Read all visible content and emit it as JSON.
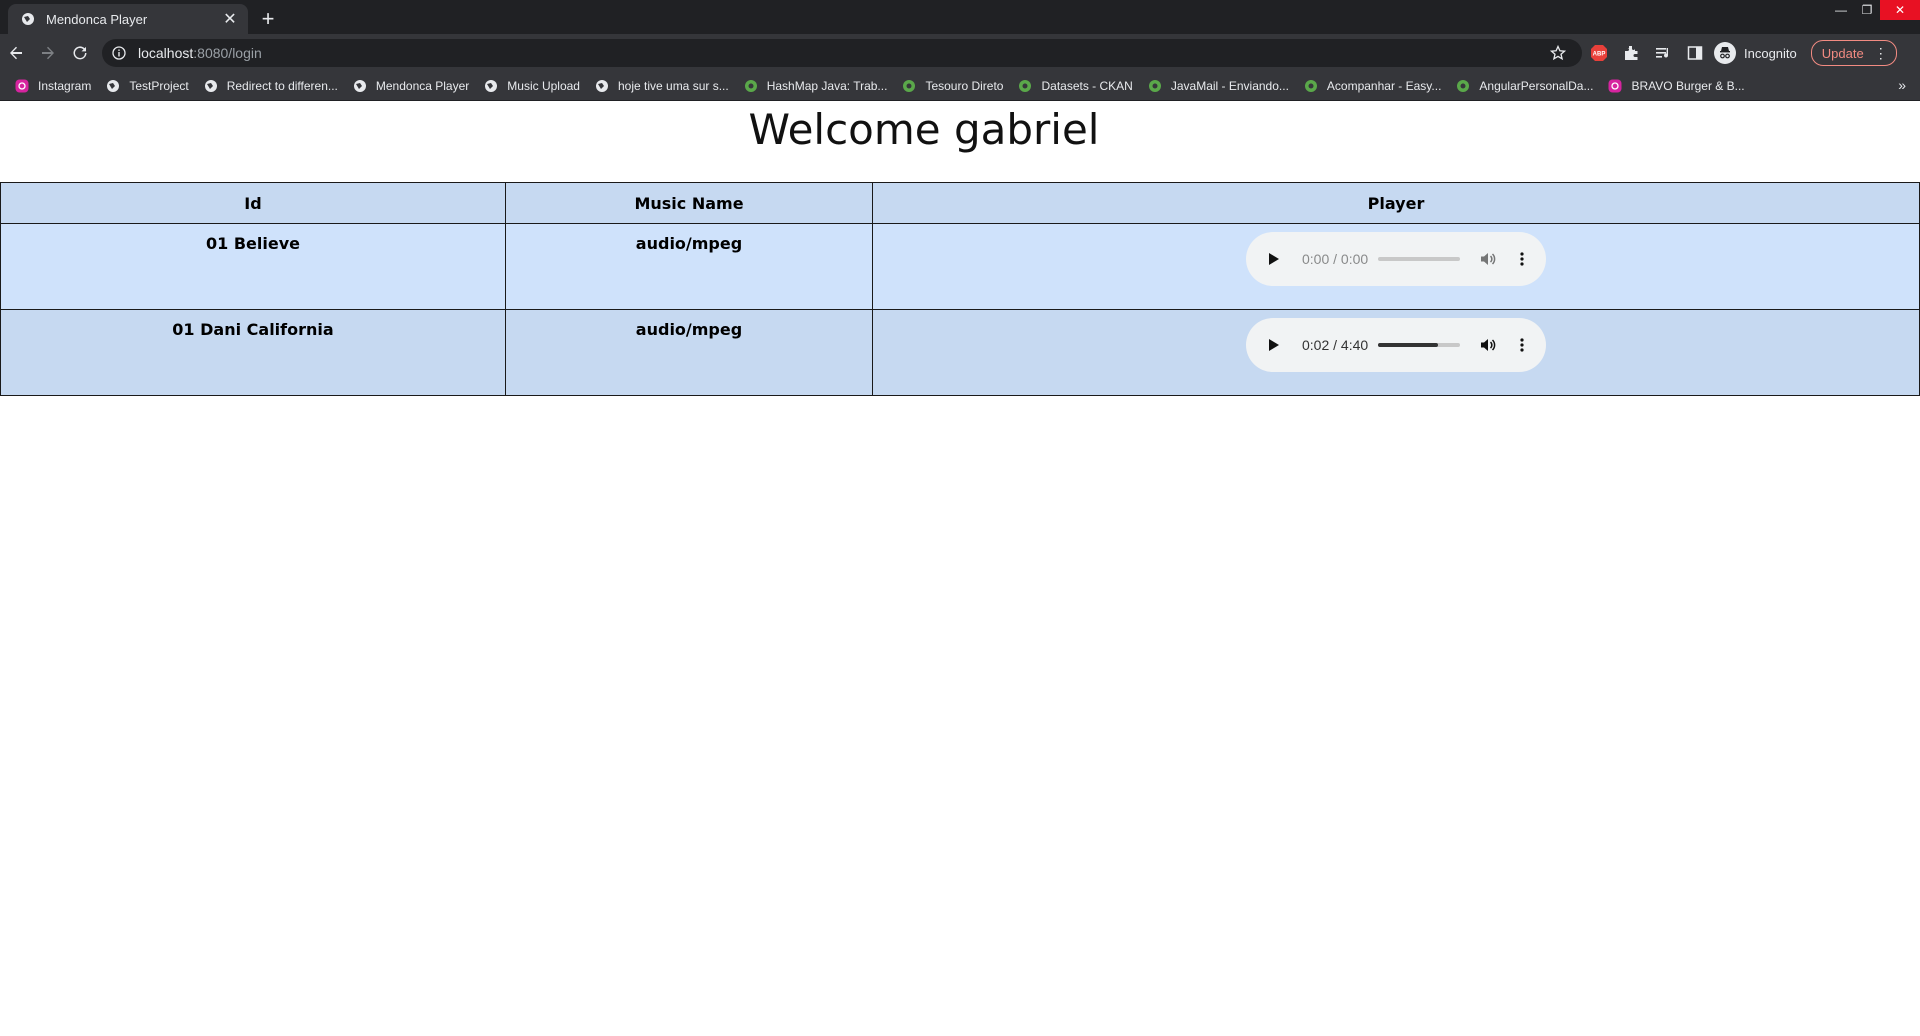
{
  "browser": {
    "tab_title": "Mendonca Player",
    "url_host": "localhost",
    "url_path": ":8080/login",
    "profile_label": "Incognito",
    "update_label": "Update",
    "bookmarks": [
      {
        "label": "Instagram",
        "icon": "instagram-icon"
      },
      {
        "label": "TestProject",
        "icon": "globe-icon"
      },
      {
        "label": "Redirect to differen...",
        "icon": "globe-icon"
      },
      {
        "label": "Mendonca Player",
        "icon": "globe-icon"
      },
      {
        "label": "Music Upload",
        "icon": "globe-icon"
      },
      {
        "label": "hoje tive uma sur s...",
        "icon": "globe-icon"
      },
      {
        "label": "HashMap Java: Trab...",
        "icon": "site-icon"
      },
      {
        "label": "Tesouro Direto",
        "icon": "site-icon"
      },
      {
        "label": "Datasets - CKAN",
        "icon": "site-icon"
      },
      {
        "label": "JavaMail - Enviando...",
        "icon": "site-icon"
      },
      {
        "label": "Acompanhar - Easy...",
        "icon": "site-icon"
      },
      {
        "label": "AngularPersonalDa...",
        "icon": "site-icon"
      },
      {
        "label": "BRAVO Burger & B...",
        "icon": "instagram-icon"
      }
    ]
  },
  "page": {
    "heading": "Welcome gabriel",
    "table": {
      "headers": {
        "id": "Id",
        "name": "Music Name",
        "player": "Player"
      },
      "rows": [
        {
          "id": "01 Believe",
          "name": "audio/mpeg",
          "time": "0:00 / 0:00",
          "progress": 0
        },
        {
          "id": "01 Dani California",
          "name": "audio/mpeg",
          "time": "0:02 / 4:40",
          "progress": 0.73
        }
      ]
    }
  }
}
